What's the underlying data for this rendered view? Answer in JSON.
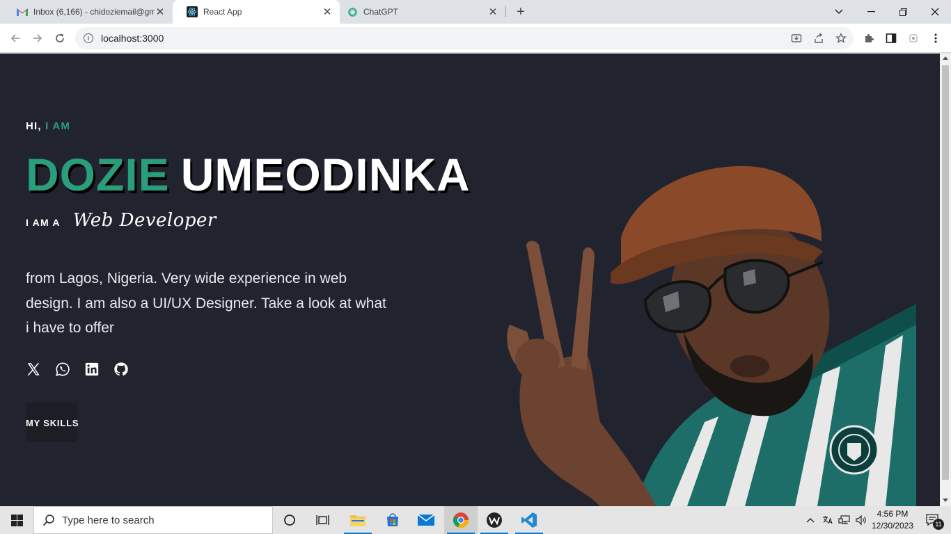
{
  "browser": {
    "tabs": [
      {
        "label": "Inbox (6,166) - chidoziemail@gm",
        "favicon": "gmail-icon"
      },
      {
        "label": "React App",
        "favicon": "react-icon",
        "active": true
      },
      {
        "label": "ChatGPT",
        "favicon": "chatgpt-icon"
      }
    ],
    "url": "localhost:3000"
  },
  "hero": {
    "greeting_prefix": "HI,",
    "greeting_accent": "I AM",
    "first_name": "DOZIE",
    "last_name": "UMEODINKA",
    "role_prefix": "I AM A",
    "role_title": "Web Developer",
    "bio": "from Lagos, Nigeria. Very wide experience in web design. I am also a UI/UX Designer. Take a look at what i have to offer",
    "socials": [
      "x-icon",
      "whatsapp-icon",
      "linkedin-icon",
      "github-icon"
    ],
    "cta_label": "MY SKILLS",
    "accent_color": "#2a9d7c",
    "background_color": "#21242f"
  },
  "taskbar": {
    "search_placeholder": "Type here to search",
    "time": "4:56 PM",
    "date": "12/30/2023",
    "notification_count": "11"
  }
}
